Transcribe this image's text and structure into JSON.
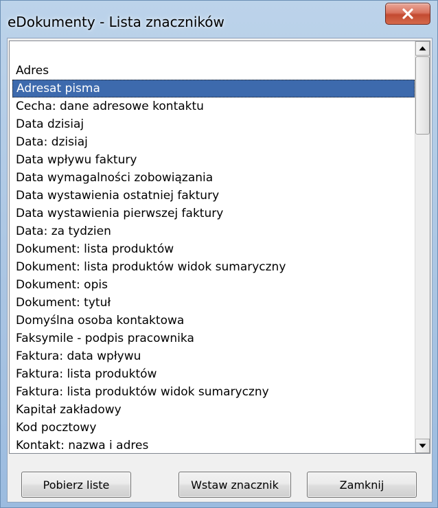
{
  "window": {
    "title": "eDokumenty - Lista znaczników"
  },
  "list": {
    "selected_index": 1,
    "items": [
      "Adres",
      "Adresat pisma",
      "Cecha: dane adresowe kontaktu",
      "Data dzisiaj",
      "Data: dzisiaj",
      "Data wpływu faktury",
      "Data wymagalności zobowiązania",
      "Data wystawienia ostatniej faktury",
      "Data wystawienia pierwszej faktury",
      "Data: za tydzien",
      "Dokument: lista produktów",
      "Dokument: lista produktów widok sumaryczny",
      "Dokument: opis",
      "Dokument: tytuł",
      "Domyślna osoba kontaktowa",
      "Faksymile - podpis pracownika",
      "Faktura: data wpływu",
      "Faktura: lista produktów",
      "Faktura: lista produktów widok sumaryczny",
      "Kapitał zakładowy",
      "Kod pocztowy",
      "Kontakt: nazwa i adres"
    ]
  },
  "buttons": {
    "get_list": "Pobierz liste",
    "insert_tag": "Wstaw znacznik",
    "close": "Zamknij"
  },
  "icons": {
    "close": "close-x-icon",
    "scroll_up": "arrow-up-icon",
    "scroll_down": "arrow-down-icon"
  },
  "colors": {
    "selection": "#3d6aad",
    "close_button": "#c34a31",
    "frame": "#a9c4e2"
  }
}
